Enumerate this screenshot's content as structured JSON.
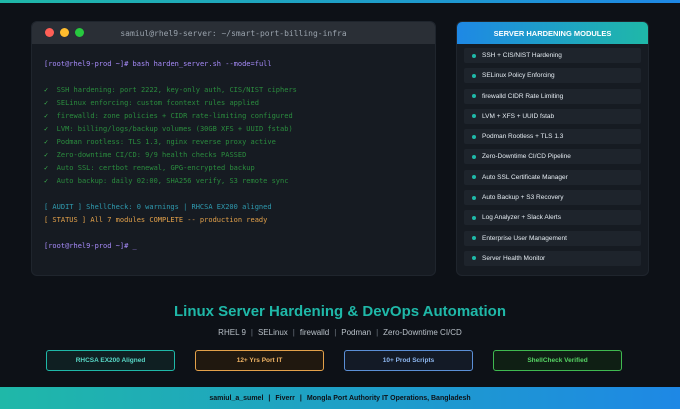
{
  "terminal": {
    "title": "samiul@rhel9-server: ~/smart-port-billing-infra",
    "prompt1": "[root@rhel9-prod ~]#",
    "command": "bash harden_server.sh --mode=full",
    "checks": [
      "SSH hardening: port 2222, key-only auth, CIS/NIST ciphers",
      "SELinux enforcing: custom fcontext rules applied",
      "firewalld: zone policies + CIDR rate-limiting configured",
      "LVM: billing/logs/backup volumes (30GB XFS + UUID fstab)",
      "Podman rootless: TLS 1.3, nginx reverse proxy active",
      "Zero-downtime CI/CD: 9/9 health checks PASSED",
      "Auto SSL: certbot renewal, GPG-encrypted backup",
      "Auto backup: daily 02:00, SHA256 verify, S3 remote sync"
    ],
    "check_mark": "✓",
    "audit_line": "[ AUDIT ] ShellCheck: 0 warnings | RHCSA EX200 aligned",
    "status_line": "[ STATUS ] All 7 modules COMPLETE -- production ready",
    "prompt2": "[root@rhel9-prod ~]# _"
  },
  "modules": {
    "header": "SERVER HARDENING MODULES",
    "items": [
      "SSH + CIS/NIST Hardening",
      "SELinux Policy Enforcing",
      "firewalld CIDR Rate Limiting",
      "LVM + XFS + UUID fstab",
      "Podman Rootless + TLS 1.3",
      "Zero-Downtime CI/CD Pipeline",
      "Auto SSL Certificate Manager",
      "Auto Backup + S3 Recovery",
      "Log Analyzer + Slack Alerts",
      "Enterprise User Management",
      "Server Health Monitor"
    ]
  },
  "headline": "Linux Server Hardening & DevOps Automation",
  "subline": [
    "RHEL 9",
    "SELinux",
    "firewalld",
    "Podman",
    "Zero-Downtime CI/CD"
  ],
  "subline_sep": "|",
  "badges": [
    "RHCSA EX200 Aligned",
    "12+ Yrs Port IT",
    "10+ Prod Scripts",
    "ShellCheck Verified"
  ],
  "footer": {
    "name": "samiul_a_sumel",
    "platform": "Fiverr",
    "org": "Mongla Port Authority IT Operations, Bangladesh",
    "sep": "|"
  },
  "colors": {
    "background": "#0d1117",
    "accent_teal": "#1fb8a8",
    "accent_blue": "#1e88e5",
    "ok_green": "#3fb950",
    "status_orange": "#e3a14a"
  }
}
